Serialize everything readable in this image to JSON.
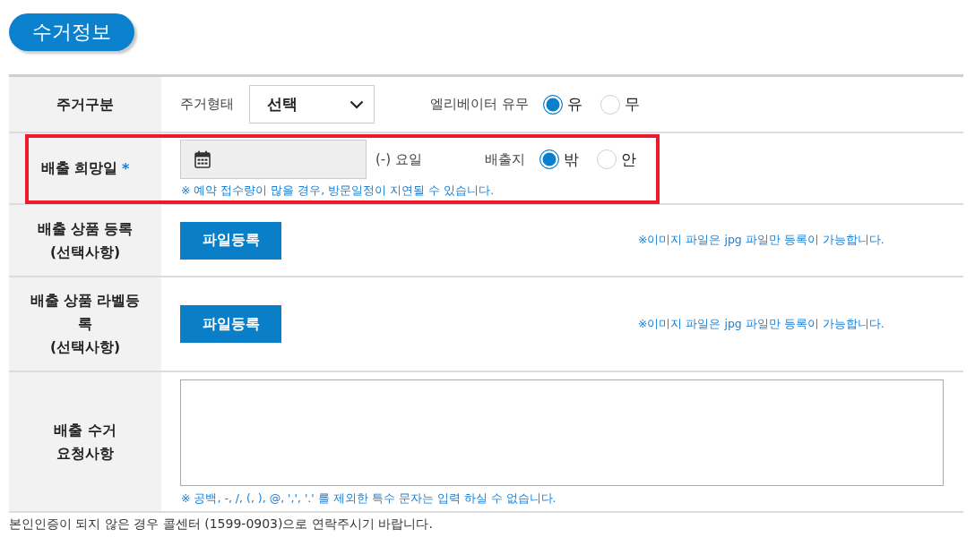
{
  "section_title": "수거정보",
  "rows": [
    {
      "kind": "housing",
      "label": [
        "주거구분"
      ],
      "highlighted": false,
      "select": {
        "label": "주거형태",
        "value": "선택"
      },
      "radio_group": {
        "label": "엘리베이터 유무",
        "options": [
          {
            "label": "유",
            "selected": true
          },
          {
            "label": "무",
            "selected": false
          }
        ]
      }
    },
    {
      "kind": "date",
      "label": [
        "배출 희망일"
      ],
      "required_mark": "*",
      "highlighted": true,
      "date_field": {
        "readonly": true
      },
      "day_text": "(-) 요일",
      "radio_group": {
        "label": "배출지",
        "options": [
          {
            "label": "밖",
            "selected": true
          },
          {
            "label": "안",
            "selected": false
          }
        ]
      },
      "note": "※ 예약 접수량이 많을 경우, 방문일정이 지연될 수 있습니다."
    },
    {
      "kind": "file",
      "label": [
        "배출 상품 등록",
        "(선택사항)"
      ],
      "highlighted": false,
      "button": "파일등록",
      "note": "※이미지 파일은 jpg 파일만 등록이 가능합니다."
    },
    {
      "kind": "file",
      "label": [
        "배출 상품 라벨등록",
        "(선택사항)"
      ],
      "highlighted": false,
      "button": "파일등록",
      "note": "※이미지 파일은 jpg 파일만 등록이 가능합니다."
    },
    {
      "kind": "textarea",
      "label": [
        "배출 수거",
        "요청사항"
      ],
      "highlighted": false,
      "note": "※ 공백, -, /, (, ), @, ',', '.' 를 제외한 특수 문자는 입력 하실 수 없습니다."
    }
  ],
  "footer_text": "본인인증이 되지 않은 경우 콜센터 (1599-0903)으로 연락주시기 바랍니다."
}
